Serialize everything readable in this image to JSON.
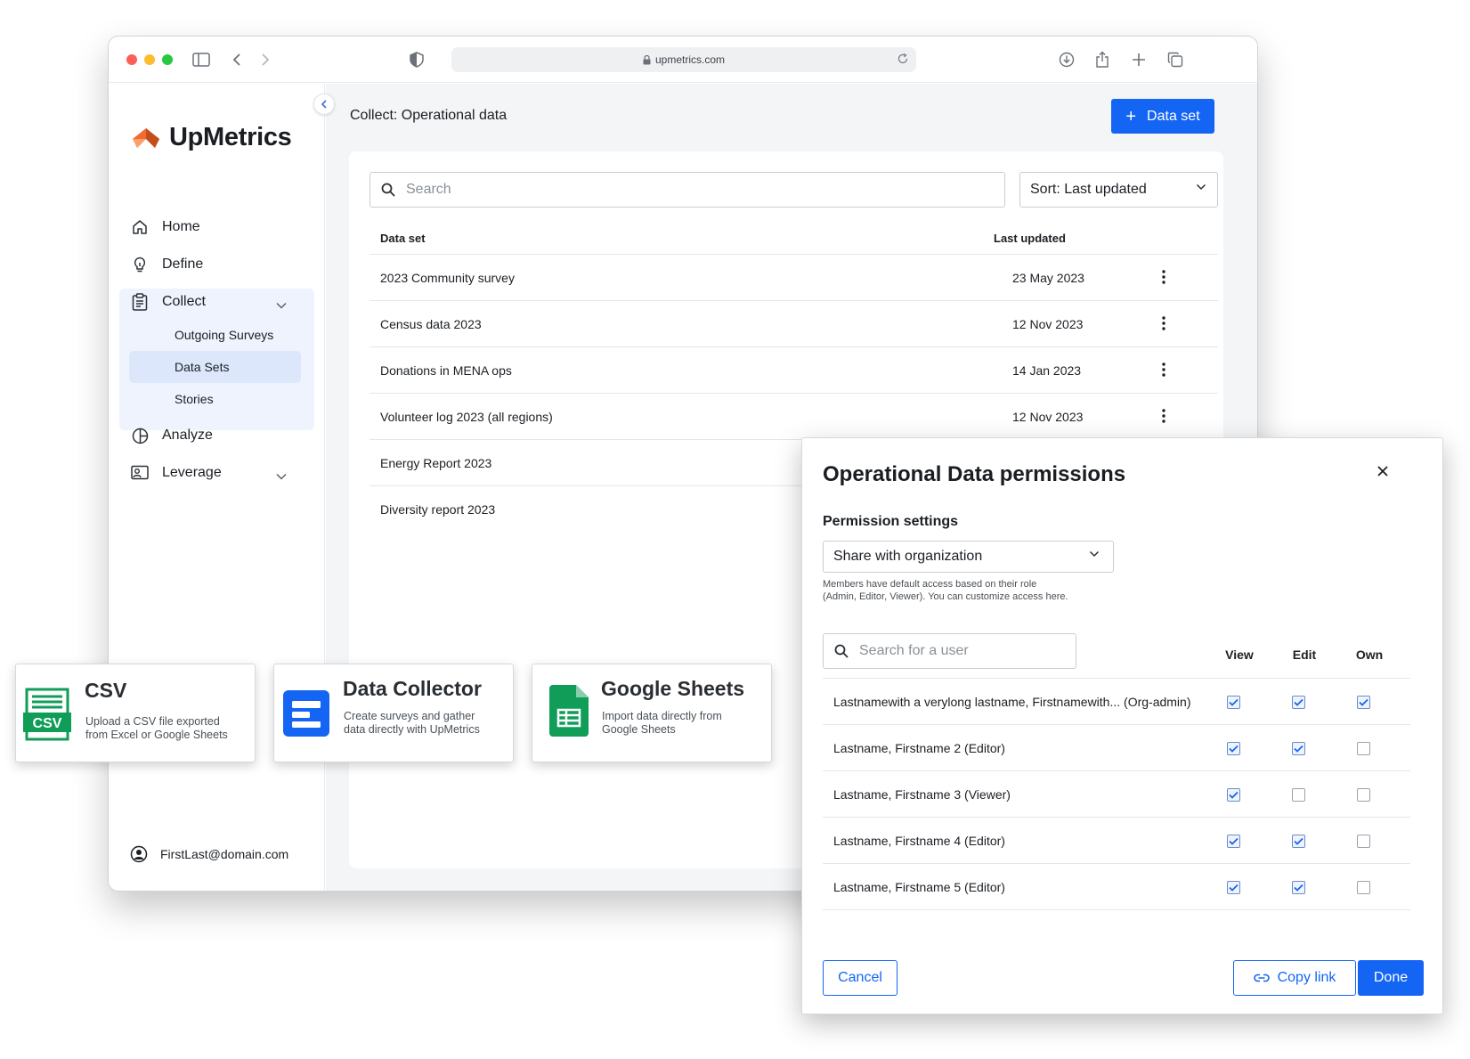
{
  "browser": {
    "url": "upmetrics.com"
  },
  "sidebar": {
    "brand": "UpMetrics",
    "items": [
      {
        "label": "Home"
      },
      {
        "label": "Define"
      },
      {
        "label": "Collect"
      },
      {
        "label": "Analyze"
      },
      {
        "label": "Leverage"
      }
    ],
    "collect_sub": [
      {
        "label": "Outgoing Surveys"
      },
      {
        "label": "Data Sets"
      },
      {
        "label": "Stories"
      }
    ],
    "user_email": "FirstLast@domain.com"
  },
  "main": {
    "title": "Collect: Operational data",
    "add_button": "Data set",
    "search_placeholder": "Search",
    "sort_label": "Sort: Last updated",
    "columns": {
      "name": "Data set",
      "updated": "Last updated"
    },
    "rows": [
      {
        "name": "2023 Community survey",
        "updated": "23 May 2023"
      },
      {
        "name": "Census data 2023",
        "updated": "12 Nov 2023"
      },
      {
        "name": "Donations in MENA ops",
        "updated": "14 Jan 2023"
      },
      {
        "name": "Volunteer log 2023 (all regions)",
        "updated": "12 Nov 2023"
      },
      {
        "name": "Energy Report 2023",
        "updated": ""
      },
      {
        "name": "Diversity report 2023",
        "updated": ""
      }
    ]
  },
  "imports": [
    {
      "title": "CSV",
      "desc_1": "Upload a CSV file exported",
      "desc_2": "from Excel or Google Sheets",
      "badge": "CSV",
      "color": "#0f9d58"
    },
    {
      "title": "Data Collector",
      "desc_1": "Create surveys and gather",
      "desc_2": "data directly with UpMetrics",
      "color": "#1565f4"
    },
    {
      "title": "Google Sheets",
      "desc_1": "Import data directly from",
      "desc_2": "Google Sheets",
      "color": "#0f9d58"
    }
  ],
  "dialog": {
    "title": "Operational Data permissions",
    "settings_heading": "Permission settings",
    "share_option": "Share with organization",
    "help_1": "Members have default access based on their role",
    "help_2": "(Admin, Editor, Viewer). You can customize access here.",
    "user_search_placeholder": "Search for a user",
    "col_view": "View",
    "col_edit": "Edit",
    "col_own": "Own",
    "users": [
      {
        "name": "Lastnamewith a verylong lastname, Firstnamewith... (Org-admin)",
        "view": true,
        "edit": true,
        "own": true
      },
      {
        "name": "Lastname, Firstname 2 (Editor)",
        "view": true,
        "edit": true,
        "own": false
      },
      {
        "name": "Lastname, Firstname 3 (Viewer)",
        "view": true,
        "edit": false,
        "own": false
      },
      {
        "name": "Lastname, Firstname 4 (Editor)",
        "view": true,
        "edit": true,
        "own": false
      },
      {
        "name": "Lastname, Firstname 5 (Editor)",
        "view": true,
        "edit": true,
        "own": false
      }
    ],
    "cancel": "Cancel",
    "copy_link": "Copy link",
    "done": "Done"
  },
  "colors": {
    "accent": "#1565f4",
    "brand_orange": "#f26a2e"
  }
}
